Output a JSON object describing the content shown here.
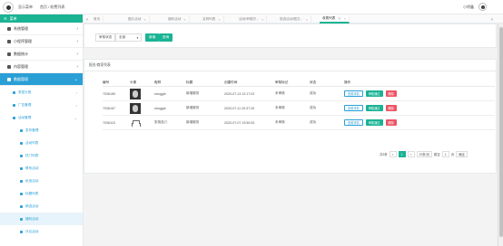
{
  "topbar": {
    "toggle_label": "显示菜单",
    "breadcrumb": "首页 / 收费列表",
    "user": "小明鑫"
  },
  "sidebar": {
    "head": "菜单",
    "items": [
      {
        "label": "系统管理"
      },
      {
        "label": "小程序管理"
      },
      {
        "label": "数据统计"
      },
      {
        "label": "内容管理"
      },
      {
        "label": "数据管理"
      }
    ],
    "subs": [
      {
        "label": "类型分类"
      },
      {
        "label": "广告管理"
      },
      {
        "label": "活动管理"
      }
    ],
    "leaves": [
      {
        "label": "发布管理"
      },
      {
        "label": "活动列表"
      },
      {
        "label": "热门列表"
      },
      {
        "label": "联系活动"
      },
      {
        "label": "私信活动"
      },
      {
        "label": "标题列表"
      },
      {
        "label": "精选活动"
      },
      {
        "label": "福利活动"
      },
      {
        "label": "评论活动"
      }
    ]
  },
  "tabs": [
    {
      "label": "首页"
    },
    {
      "label": "图片活动"
    },
    {
      "label": "福利活动"
    },
    {
      "label": "名称列表"
    },
    {
      "label": "活动/审核历..."
    },
    {
      "label": "旅游活动/图文..."
    },
    {
      "label": "收费列表"
    }
  ],
  "filter": {
    "label": "审核状态",
    "select_value": "全部",
    "add_label": "新增",
    "query_label": "查询"
  },
  "table": {
    "title": "报名/商家列表",
    "headers": [
      "编号",
      "头像",
      "昵称",
      "标题",
      "创建时间",
      "审核标记",
      "状态",
      "操作"
    ],
    "rows": [
      {
        "id": "7036180",
        "nick": "struggle",
        "title": "新增服务",
        "time": "2020-07-13 12:17:02",
        "mark": "未审核",
        "status": "成功"
      },
      {
        "id": "7036167",
        "nick": "struggle",
        "title": "新增服务",
        "time": "2020-07-11 20:37:25",
        "mark": "未审核",
        "status": "成功"
      },
      {
        "id": "7036115",
        "nick": "张扬品◎",
        "title": "新增服务",
        "time": "2020-07-07 19:50:53",
        "mark": "未审核",
        "status": "成功"
      }
    ],
    "actions": {
      "view": "查看详情",
      "approve": "审核通过",
      "delete": "删除"
    }
  },
  "pager": {
    "total": "共3条",
    "prev": "<",
    "current": "1",
    "next": ">",
    "per_page": "20条/页",
    "goto_prefix": "跳至",
    "goto_value": "1",
    "goto_suffix": "页",
    "confirm": "确定"
  }
}
